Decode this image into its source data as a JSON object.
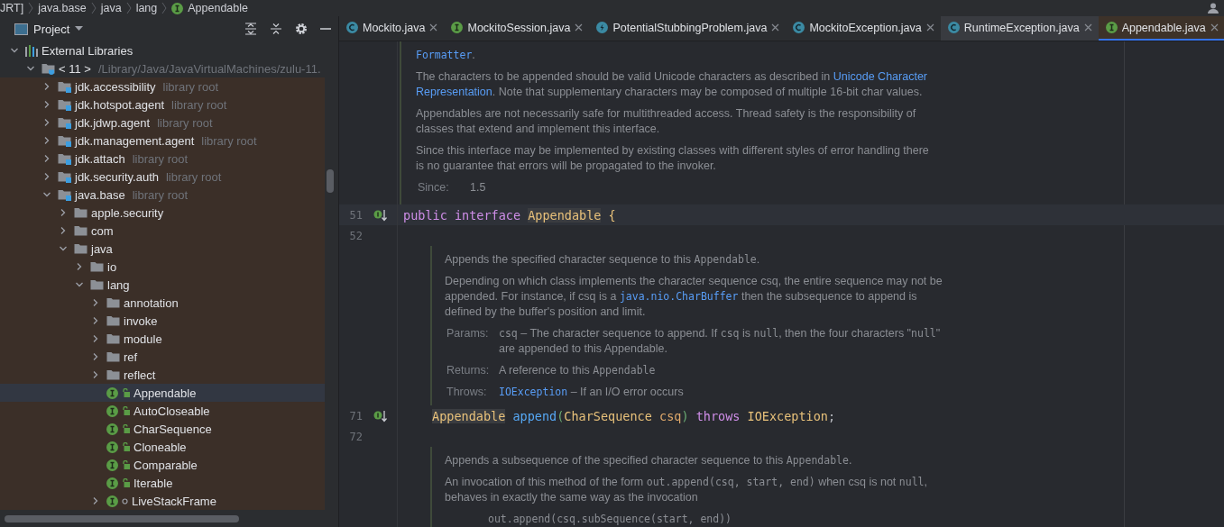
{
  "breadcrumbs": [
    {
      "label": "JRT]"
    },
    {
      "label": "java.base"
    },
    {
      "label": "java"
    },
    {
      "label": "lang"
    },
    {
      "label": "Appendable",
      "kind": "interface"
    }
  ],
  "project_panel": {
    "title": "Project",
    "tree": [
      {
        "label": "External Libraries",
        "kind": "libraries",
        "expanded": true,
        "selected": false,
        "children": [
          {
            "label": "< 11 >",
            "note": "/Library/Java/JavaVirtualMachines/zulu-11.",
            "kind": "jdk",
            "expanded": true,
            "selected": false,
            "children": [
              {
                "label": "jdk.accessibility",
                "note": "library root",
                "kind": "module",
                "expanded": false,
                "selected": false
              },
              {
                "label": "jdk.hotspot.agent",
                "note": "library root",
                "kind": "module",
                "expanded": false,
                "selected": false
              },
              {
                "label": "jdk.jdwp.agent",
                "note": "library root",
                "kind": "module",
                "expanded": false,
                "selected": false
              },
              {
                "label": "jdk.management.agent",
                "note": "library root",
                "kind": "module",
                "expanded": false,
                "selected": false
              },
              {
                "label": "jdk.attach",
                "note": "library root",
                "kind": "module",
                "expanded": false,
                "selected": false
              },
              {
                "label": "jdk.security.auth",
                "note": "library root",
                "kind": "module",
                "expanded": false,
                "selected": false
              },
              {
                "label": "java.base",
                "note": "library root",
                "kind": "module",
                "expanded": true,
                "selected": false,
                "children": [
                  {
                    "label": "apple.security",
                    "kind": "folder",
                    "expanded": false,
                    "selected": false
                  },
                  {
                    "label": "com",
                    "kind": "folder",
                    "expanded": false,
                    "selected": false
                  },
                  {
                    "label": "java",
                    "kind": "folder",
                    "expanded": true,
                    "selected": false,
                    "children": [
                      {
                        "label": "io",
                        "kind": "folder",
                        "expanded": false,
                        "selected": false
                      },
                      {
                        "label": "lang",
                        "kind": "folder",
                        "expanded": true,
                        "selected": false,
                        "children": [
                          {
                            "label": "annotation",
                            "kind": "folder",
                            "expanded": false,
                            "selected": false
                          },
                          {
                            "label": "invoke",
                            "kind": "folder",
                            "expanded": false,
                            "selected": false
                          },
                          {
                            "label": "module",
                            "kind": "folder",
                            "expanded": false,
                            "selected": false
                          },
                          {
                            "label": "ref",
                            "kind": "folder",
                            "expanded": false,
                            "selected": false
                          },
                          {
                            "label": "reflect",
                            "kind": "folder",
                            "expanded": false,
                            "selected": false
                          },
                          {
                            "label": "Appendable",
                            "kind": "interface",
                            "public": true,
                            "selected": true
                          },
                          {
                            "label": "AutoCloseable",
                            "kind": "interface",
                            "public": true,
                            "selected": false
                          },
                          {
                            "label": "CharSequence",
                            "kind": "interface",
                            "public": true,
                            "selected": false
                          },
                          {
                            "label": "Cloneable",
                            "kind": "interface",
                            "public": true,
                            "selected": false
                          },
                          {
                            "label": "Comparable",
                            "kind": "interface",
                            "public": true,
                            "selected": false
                          },
                          {
                            "label": "Iterable",
                            "kind": "interface",
                            "public": true,
                            "selected": false
                          },
                          {
                            "label": "LiveStackFrame",
                            "kind": "interface",
                            "public": false,
                            "expanded": false,
                            "selected": false
                          }
                        ]
                      }
                    ]
                  }
                ]
              }
            ]
          }
        ]
      }
    ]
  },
  "editor": {
    "tabs": [
      {
        "label": "Mockito.java",
        "kind": "class",
        "selected": false,
        "hovered": false
      },
      {
        "label": "MockitoSession.java",
        "kind": "interface",
        "selected": false,
        "hovered": false
      },
      {
        "label": "PotentialStubbingProblem.java",
        "kind": "exception",
        "selected": false,
        "hovered": false
      },
      {
        "label": "MockitoException.java",
        "kind": "class",
        "selected": false,
        "hovered": false
      },
      {
        "label": "RuntimeException.java",
        "kind": "class",
        "selected": false,
        "hovered": true
      },
      {
        "label": "Appendable.java",
        "kind": "interface",
        "selected": true,
        "hovered": false
      }
    ],
    "blocks": [
      {
        "kind": "doc",
        "nested": false,
        "paragraphs": [
          {
            "kind": "text",
            "lines": [
              [
                {
                  "kind": "codelink",
                  "t": "Formatter"
                },
                {
                  "kind": "text",
                  "t": "."
                }
              ]
            ]
          },
          {
            "kind": "text",
            "lines": [
              [
                {
                  "kind": "text",
                  "t": "The characters to be appended should be valid Unicode characters as described in "
                },
                {
                  "kind": "link",
                  "t": "Unicode Character"
                }
              ],
              [
                {
                  "kind": "link",
                  "t": "Representation"
                },
                {
                  "kind": "text",
                  "t": ". Note that supplementary characters may be composed of multiple 16-bit char values."
                }
              ]
            ]
          },
          {
            "kind": "text",
            "lines": [
              [
                {
                  "kind": "text",
                  "t": "Appendables are not necessarily safe for multithreaded access. Thread safety is the responsibility of"
                }
              ],
              [
                {
                  "kind": "text",
                  "t": "classes that extend and implement this interface."
                }
              ]
            ]
          },
          {
            "kind": "text",
            "lines": [
              [
                {
                  "kind": "text",
                  "t": "Since this interface may be implemented by existing classes with different styles of error handling there"
                }
              ],
              [
                {
                  "kind": "text",
                  "t": "is no guarantee that errors will be propagated to the invoker."
                }
              ]
            ]
          },
          {
            "kind": "tag",
            "label": "Since:",
            "lines": [
              [
                {
                  "kind": "text",
                  "t": "1.5"
                }
              ]
            ]
          }
        ]
      },
      {
        "kind": "code",
        "number": "51",
        "implemented": true,
        "current": true,
        "nested": false,
        "tokens": [
          {
            "kind": "keyword",
            "t": "public "
          },
          {
            "kind": "keyword",
            "t": "interface "
          },
          {
            "kind": "type",
            "t": "Appendable",
            "highlighted": true
          },
          {
            "kind": "brace",
            "t": " {"
          }
        ]
      },
      {
        "kind": "blank",
        "number": "52"
      },
      {
        "kind": "doc",
        "nested": true,
        "paragraphs": [
          {
            "kind": "text",
            "lines": [
              [
                {
                  "kind": "text",
                  "t": "Appends the specified character sequence to this "
                },
                {
                  "kind": "code",
                  "t": "Appendable"
                },
                {
                  "kind": "text",
                  "t": "."
                }
              ]
            ]
          },
          {
            "kind": "text",
            "lines": [
              [
                {
                  "kind": "text",
                  "t": "Depending on which class implements the character sequence csq, the entire sequence may not be"
                }
              ],
              [
                {
                  "kind": "text",
                  "t": "appended. For instance, if csq is a "
                },
                {
                  "kind": "codelink",
                  "t": "java.nio.CharBuffer"
                },
                {
                  "kind": "text",
                  "t": " then the subsequence to append is"
                }
              ],
              [
                {
                  "kind": "text",
                  "t": "defined by the buffer's position and limit."
                }
              ]
            ]
          },
          {
            "kind": "tag",
            "label": "Params:",
            "lines": [
              [
                {
                  "kind": "code",
                  "t": "csq"
                },
                {
                  "kind": "text",
                  "t": " – The character sequence to append. If "
                },
                {
                  "kind": "code",
                  "t": "csq"
                },
                {
                  "kind": "text",
                  "t": " is "
                },
                {
                  "kind": "code",
                  "t": "null"
                },
                {
                  "kind": "text",
                  "t": ", then the four characters \""
                },
                {
                  "kind": "code",
                  "t": "null"
                },
                {
                  "kind": "text",
                  "t": "\""
                }
              ],
              [
                {
                  "kind": "text",
                  "t": "are appended to this Appendable."
                }
              ]
            ]
          },
          {
            "kind": "tag",
            "label": "Returns:",
            "lines": [
              [
                {
                  "kind": "text",
                  "t": "A reference to this "
                },
                {
                  "kind": "code",
                  "t": "Appendable"
                }
              ]
            ]
          },
          {
            "kind": "tag",
            "label": "Throws:",
            "lines": [
              [
                {
                  "kind": "codelink",
                  "t": "IOException"
                },
                {
                  "kind": "text",
                  "t": " – If an I/O error occurs"
                }
              ]
            ]
          }
        ]
      },
      {
        "kind": "code",
        "number": "71",
        "implemented": true,
        "current": false,
        "nested": true,
        "tokens": [
          {
            "kind": "type",
            "t": "Appendable",
            "highlighted": true
          },
          {
            "kind": "method",
            "t": " append"
          },
          {
            "kind": "paren",
            "t": "("
          },
          {
            "kind": "type",
            "t": "CharSequence "
          },
          {
            "kind": "param",
            "t": "csq"
          },
          {
            "kind": "paren",
            "t": ")"
          },
          {
            "kind": "keyword",
            "t": " throws "
          },
          {
            "kind": "type",
            "t": "IOException"
          },
          {
            "kind": "punct",
            "t": ";"
          }
        ]
      },
      {
        "kind": "blank",
        "number": "72"
      },
      {
        "kind": "doc",
        "nested": true,
        "paragraphs": [
          {
            "kind": "text",
            "lines": [
              [
                {
                  "kind": "text",
                  "t": "Appends a subsequence of the specified character sequence to this "
                },
                {
                  "kind": "code",
                  "t": "Appendable"
                },
                {
                  "kind": "text",
                  "t": "."
                }
              ]
            ]
          },
          {
            "kind": "text",
            "lines": [
              [
                {
                  "kind": "text",
                  "t": "An invocation of this method of the form "
                },
                {
                  "kind": "code",
                  "t": "out.append(csq, start, end)"
                },
                {
                  "kind": "text",
                  "t": " when csq is not "
                },
                {
                  "kind": "code",
                  "t": "null"
                },
                {
                  "kind": "text",
                  "t": ","
                }
              ],
              [
                {
                  "kind": "text",
                  "t": "behaves in exactly the same way as the invocation"
                }
              ]
            ]
          },
          {
            "kind": "pre",
            "lines": [
              [
                {
                  "kind": "code",
                  "t": "out.append(csq.subSequence(start, end))"
                }
              ]
            ]
          }
        ]
      }
    ]
  }
}
